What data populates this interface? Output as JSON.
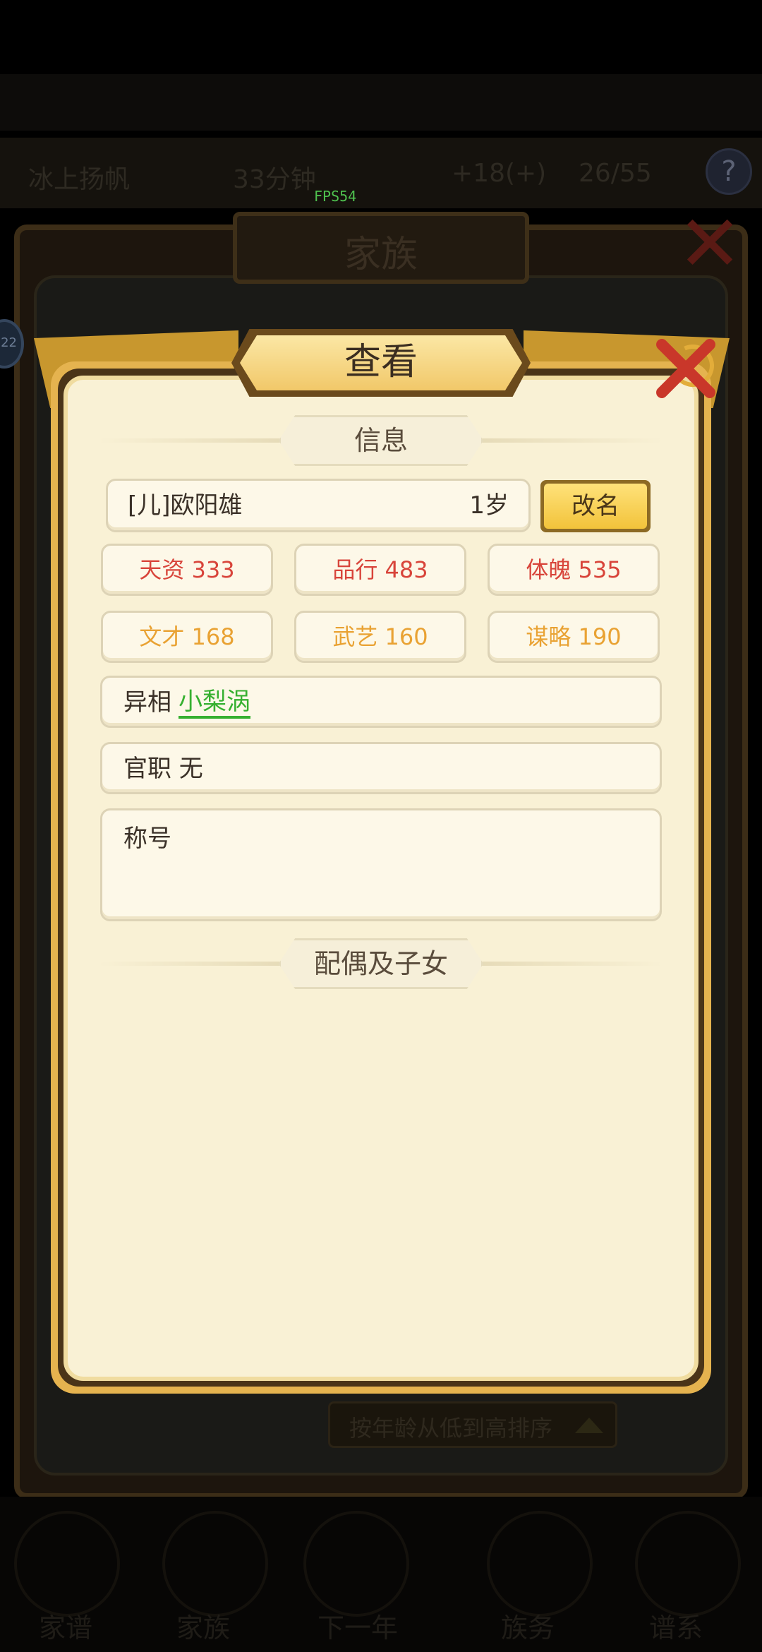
{
  "background": {
    "hud_text": [
      "冰上扬帆",
      "33分钟",
      "+18(+)",
      "26/55"
    ],
    "help_icon": "?",
    "fps": "FPS54",
    "screen_title": "家族",
    "side_badge": "22",
    "sort_button": "按年龄从低到高排序",
    "bottom_nav": [
      "家谱",
      "家族",
      "下一年",
      "族务",
      "谱系"
    ]
  },
  "modal": {
    "title": "查看",
    "info_section": "信息",
    "name": "[儿]欧阳雄",
    "age": "1岁",
    "rename_button": "改名",
    "stats_row1": [
      {
        "label": "天资 333",
        "color": "#d8443a"
      },
      {
        "label": "品行 483",
        "color": "#d8443a"
      },
      {
        "label": "体魄 535",
        "color": "#d8443a"
      }
    ],
    "stats_row2": [
      {
        "label": "文才 168",
        "color": "#e9a233"
      },
      {
        "label": "武艺 160",
        "color": "#e9a233"
      },
      {
        "label": "谋略 190",
        "color": "#e9a233"
      }
    ],
    "trait_label": "异相",
    "trait_value": "小梨涡",
    "office": "官职 无",
    "title_label": "称号",
    "spouse_section": "配偶及子女"
  }
}
